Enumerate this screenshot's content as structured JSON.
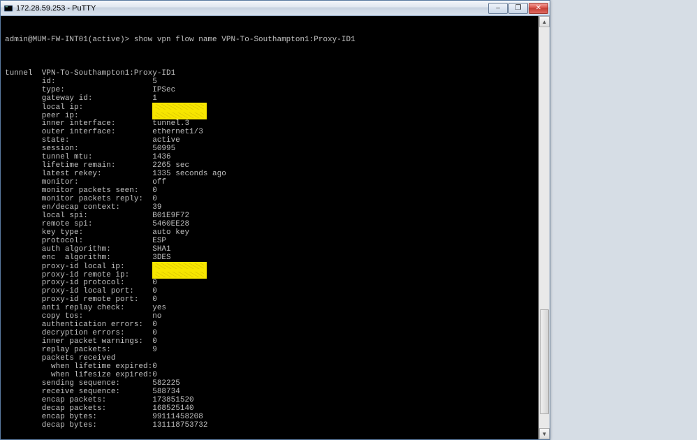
{
  "window": {
    "title": "172.28.59.253 - PuTTY",
    "minimize_icon": "–",
    "maximize_icon": "❐",
    "close_icon": "✕"
  },
  "prompt": "admin@MUM-FW-INT01(active)> show vpn flow name VPN-To-Southampton1:Proxy-ID1",
  "header_lbl": "tunnel",
  "header_val": "VPN-To-Southampton1:Proxy-ID1",
  "rows": [
    {
      "lbl": "id:",
      "val": "5"
    },
    {
      "lbl": "type:",
      "val": "IPSec"
    },
    {
      "lbl": "gateway id:",
      "val": "1"
    },
    {
      "lbl": "local ip:",
      "val": "",
      "redact": true
    },
    {
      "lbl": "peer ip:",
      "val": "",
      "redact": true
    },
    {
      "lbl": "inner interface:",
      "val": "tunnel.3"
    },
    {
      "lbl": "outer interface:",
      "val": "ethernet1/3"
    },
    {
      "lbl": "state:",
      "val": "active"
    },
    {
      "lbl": "session:",
      "val": "50995"
    },
    {
      "lbl": "tunnel mtu:",
      "val": "1436"
    },
    {
      "lbl": "lifetime remain:",
      "val": "2265 sec"
    },
    {
      "lbl": "latest rekey:",
      "val": "1335 seconds ago"
    },
    {
      "lbl": "monitor:",
      "val": "off"
    },
    {
      "lbl": "monitor packets seen:",
      "val": "0"
    },
    {
      "lbl": "monitor packets reply:",
      "val": "0"
    },
    {
      "lbl": "en/decap context:",
      "val": "39"
    },
    {
      "lbl": "local spi:",
      "val": "B01E9F72"
    },
    {
      "lbl": "remote spi:",
      "val": "5460EE28"
    },
    {
      "lbl": "key type:",
      "val": "auto key"
    },
    {
      "lbl": "protocol:",
      "val": "ESP"
    },
    {
      "lbl": "auth algorithm:",
      "val": "SHA1"
    },
    {
      "lbl": "enc  algorithm:",
      "val": "3DES"
    },
    {
      "lbl": "proxy-id local ip:",
      "val": "",
      "redact": true
    },
    {
      "lbl": "proxy-id remote ip:",
      "val": "",
      "redact": true
    },
    {
      "lbl": "proxy-id protocol:",
      "val": "0"
    },
    {
      "lbl": "proxy-id local port:",
      "val": "0"
    },
    {
      "lbl": "proxy-id remote port:",
      "val": "0"
    },
    {
      "lbl": "anti replay check:",
      "val": "yes"
    },
    {
      "lbl": "copy tos:",
      "val": "no"
    },
    {
      "lbl": "authentication errors:",
      "val": "0"
    },
    {
      "lbl": "decryption errors:",
      "val": "0"
    },
    {
      "lbl": "inner packet warnings:",
      "val": "0"
    },
    {
      "lbl": "replay packets:",
      "val": "9"
    },
    {
      "lbl": "packets received",
      "val": ""
    },
    {
      "lbl": "  when lifetime expired:0",
      "val": "",
      "noCol": true
    },
    {
      "lbl": "  when lifesize expired:0",
      "val": "",
      "noCol": true
    },
    {
      "lbl": "sending sequence:",
      "val": "582225"
    },
    {
      "lbl": "receive sequence:",
      "val": "588734"
    },
    {
      "lbl": "encap packets:",
      "val": "173851520"
    },
    {
      "lbl": "decap packets:",
      "val": "168525140"
    },
    {
      "lbl": "encap bytes:",
      "val": "99111458208"
    },
    {
      "lbl": "decap bytes:",
      "val": "131118753732"
    }
  ],
  "label_col": 8,
  "value_col": 32
}
